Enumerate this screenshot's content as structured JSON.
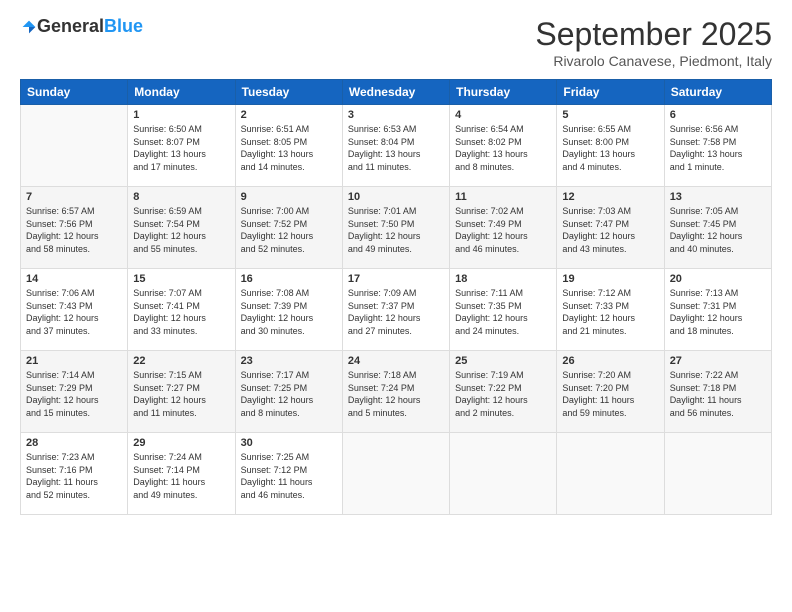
{
  "logo": {
    "general": "General",
    "blue": "Blue"
  },
  "title": "September 2025",
  "location": "Rivarolo Canavese, Piedmont, Italy",
  "days_of_week": [
    "Sunday",
    "Monday",
    "Tuesday",
    "Wednesday",
    "Thursday",
    "Friday",
    "Saturday"
  ],
  "weeks": [
    [
      {
        "day": "",
        "info": ""
      },
      {
        "day": "1",
        "info": "Sunrise: 6:50 AM\nSunset: 8:07 PM\nDaylight: 13 hours\nand 17 minutes."
      },
      {
        "day": "2",
        "info": "Sunrise: 6:51 AM\nSunset: 8:05 PM\nDaylight: 13 hours\nand 14 minutes."
      },
      {
        "day": "3",
        "info": "Sunrise: 6:53 AM\nSunset: 8:04 PM\nDaylight: 13 hours\nand 11 minutes."
      },
      {
        "day": "4",
        "info": "Sunrise: 6:54 AM\nSunset: 8:02 PM\nDaylight: 13 hours\nand 8 minutes."
      },
      {
        "day": "5",
        "info": "Sunrise: 6:55 AM\nSunset: 8:00 PM\nDaylight: 13 hours\nand 4 minutes."
      },
      {
        "day": "6",
        "info": "Sunrise: 6:56 AM\nSunset: 7:58 PM\nDaylight: 13 hours\nand 1 minute."
      }
    ],
    [
      {
        "day": "7",
        "info": "Sunrise: 6:57 AM\nSunset: 7:56 PM\nDaylight: 12 hours\nand 58 minutes."
      },
      {
        "day": "8",
        "info": "Sunrise: 6:59 AM\nSunset: 7:54 PM\nDaylight: 12 hours\nand 55 minutes."
      },
      {
        "day": "9",
        "info": "Sunrise: 7:00 AM\nSunset: 7:52 PM\nDaylight: 12 hours\nand 52 minutes."
      },
      {
        "day": "10",
        "info": "Sunrise: 7:01 AM\nSunset: 7:50 PM\nDaylight: 12 hours\nand 49 minutes."
      },
      {
        "day": "11",
        "info": "Sunrise: 7:02 AM\nSunset: 7:49 PM\nDaylight: 12 hours\nand 46 minutes."
      },
      {
        "day": "12",
        "info": "Sunrise: 7:03 AM\nSunset: 7:47 PM\nDaylight: 12 hours\nand 43 minutes."
      },
      {
        "day": "13",
        "info": "Sunrise: 7:05 AM\nSunset: 7:45 PM\nDaylight: 12 hours\nand 40 minutes."
      }
    ],
    [
      {
        "day": "14",
        "info": "Sunrise: 7:06 AM\nSunset: 7:43 PM\nDaylight: 12 hours\nand 37 minutes."
      },
      {
        "day": "15",
        "info": "Sunrise: 7:07 AM\nSunset: 7:41 PM\nDaylight: 12 hours\nand 33 minutes."
      },
      {
        "day": "16",
        "info": "Sunrise: 7:08 AM\nSunset: 7:39 PM\nDaylight: 12 hours\nand 30 minutes."
      },
      {
        "day": "17",
        "info": "Sunrise: 7:09 AM\nSunset: 7:37 PM\nDaylight: 12 hours\nand 27 minutes."
      },
      {
        "day": "18",
        "info": "Sunrise: 7:11 AM\nSunset: 7:35 PM\nDaylight: 12 hours\nand 24 minutes."
      },
      {
        "day": "19",
        "info": "Sunrise: 7:12 AM\nSunset: 7:33 PM\nDaylight: 12 hours\nand 21 minutes."
      },
      {
        "day": "20",
        "info": "Sunrise: 7:13 AM\nSunset: 7:31 PM\nDaylight: 12 hours\nand 18 minutes."
      }
    ],
    [
      {
        "day": "21",
        "info": "Sunrise: 7:14 AM\nSunset: 7:29 PM\nDaylight: 12 hours\nand 15 minutes."
      },
      {
        "day": "22",
        "info": "Sunrise: 7:15 AM\nSunset: 7:27 PM\nDaylight: 12 hours\nand 11 minutes."
      },
      {
        "day": "23",
        "info": "Sunrise: 7:17 AM\nSunset: 7:25 PM\nDaylight: 12 hours\nand 8 minutes."
      },
      {
        "day": "24",
        "info": "Sunrise: 7:18 AM\nSunset: 7:24 PM\nDaylight: 12 hours\nand 5 minutes."
      },
      {
        "day": "25",
        "info": "Sunrise: 7:19 AM\nSunset: 7:22 PM\nDaylight: 12 hours\nand 2 minutes."
      },
      {
        "day": "26",
        "info": "Sunrise: 7:20 AM\nSunset: 7:20 PM\nDaylight: 11 hours\nand 59 minutes."
      },
      {
        "day": "27",
        "info": "Sunrise: 7:22 AM\nSunset: 7:18 PM\nDaylight: 11 hours\nand 56 minutes."
      }
    ],
    [
      {
        "day": "28",
        "info": "Sunrise: 7:23 AM\nSunset: 7:16 PM\nDaylight: 11 hours\nand 52 minutes."
      },
      {
        "day": "29",
        "info": "Sunrise: 7:24 AM\nSunset: 7:14 PM\nDaylight: 11 hours\nand 49 minutes."
      },
      {
        "day": "30",
        "info": "Sunrise: 7:25 AM\nSunset: 7:12 PM\nDaylight: 11 hours\nand 46 minutes."
      },
      {
        "day": "",
        "info": ""
      },
      {
        "day": "",
        "info": ""
      },
      {
        "day": "",
        "info": ""
      },
      {
        "day": "",
        "info": ""
      }
    ]
  ]
}
